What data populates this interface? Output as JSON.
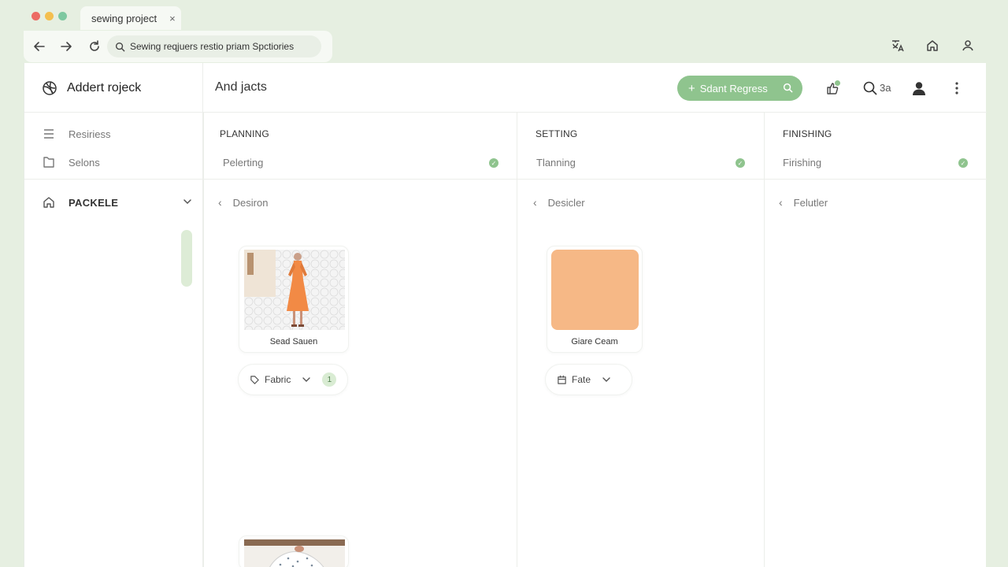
{
  "window": {
    "tab_title": "sewing project",
    "tab_close": "×",
    "address": "Sewing reqjuers restio priam  Spctiories",
    "traffic_colors": [
      "#ec6b64",
      "#f4bf4f",
      "#7ec8a0"
    ]
  },
  "sidebar": {
    "brand": "Addert rojeck",
    "items": [
      {
        "label": "Resiriess",
        "icon": "list-icon"
      },
      {
        "label": "Selons",
        "icon": "folder-icon"
      }
    ],
    "group": {
      "label": "PACKELE",
      "icon": "home-icon"
    }
  },
  "header": {
    "title": "And jacts",
    "cta_label": "Sdant Regress",
    "search_count": "3a"
  },
  "columns": [
    {
      "title": "PLANNING",
      "subtitle": "Pelerting",
      "back_label": "Desiron",
      "cards": [
        {
          "label": "Sead Sauen"
        },
        {
          "label": ""
        }
      ],
      "pill": {
        "label": "Fabric",
        "count": "1"
      }
    },
    {
      "title": "SETTING",
      "subtitle": "Tlanning",
      "back_label": "Desicler",
      "cards": [
        {
          "label": "Giare Ceam"
        }
      ],
      "pill": {
        "label": "Fate"
      }
    },
    {
      "title": "FINISHING",
      "subtitle": "Firishing",
      "back_label": "Felutler",
      "cards": []
    }
  ],
  "colors": {
    "accent": "#8fc48e",
    "page_bg": "#e6efe1",
    "swatch": "#f6b886",
    "dress": "#f28a45"
  }
}
